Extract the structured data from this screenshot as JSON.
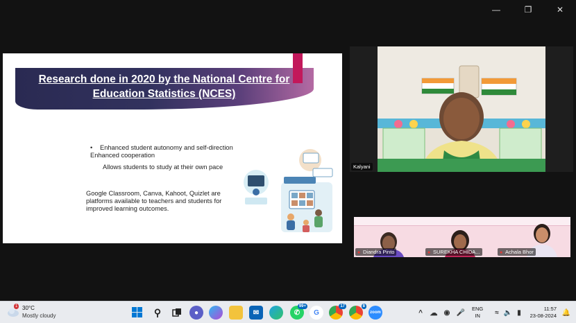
{
  "slide": {
    "title": "Research done in 2020 by the National Centre for Education Statistics (NCES)",
    "bullets": [
      "Enhanced student autonomy and self-direction",
      "Enhanced cooperation",
      "Allows students to study at their own pace"
    ],
    "paragraph": "Google Classroom, Canva, Kahoot, Quizlet are platforms available to teachers and students for improved learning outcomes."
  },
  "participants": {
    "main": "Kalyani",
    "tiles": [
      "Diandra Pinto",
      "SUREKHA CHIDA...",
      "Achala Bhor"
    ]
  },
  "taskbar": {
    "weather_temp": "30°C",
    "weather_cond": "Mostly cloudy",
    "weather_badge": "1",
    "whatsapp_badge": "99+",
    "chrome_badge": "17",
    "chrome2_badge": "8",
    "lang_line1": "ENG",
    "lang_line2": "IN",
    "time": "11:57",
    "date": "23-08-2024"
  },
  "colors": {
    "background": "#121212",
    "title_banner": "#32325e",
    "accent": "#c2185b",
    "taskbar": "#e9ebef"
  }
}
